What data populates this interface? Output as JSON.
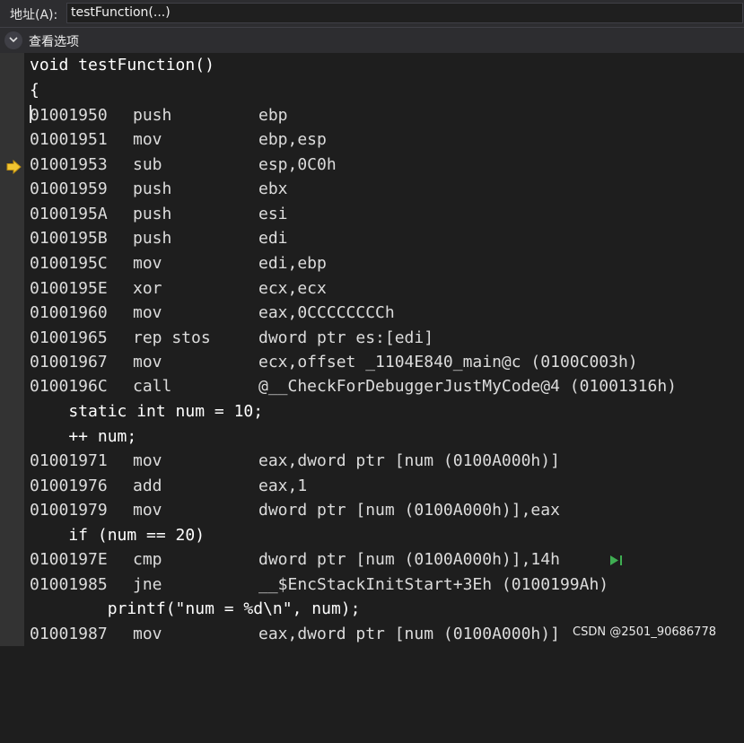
{
  "address_bar": {
    "label": "地址(A):",
    "value": "testFunction(...)"
  },
  "view_bar": {
    "label": "查看选项",
    "icon": "chevron-down-icon"
  },
  "source_lines": {
    "signature": "void testFunction()",
    "open_brace": "{",
    "static_decl": "    static int num = 10;",
    "increment": "    ++ num;",
    "if_stmt": "    if (num == 20)",
    "printf_stmt": "        printf(\"num = %d\\n\", num);"
  },
  "instructions": [
    {
      "address": "01001950",
      "mnemonic": "push",
      "operands": "ebp"
    },
    {
      "address": "01001951",
      "mnemonic": "mov",
      "operands": "ebp,esp"
    },
    {
      "address": "01001953",
      "mnemonic": "sub",
      "operands": "esp,0C0h"
    },
    {
      "address": "01001959",
      "mnemonic": "push",
      "operands": "ebx"
    },
    {
      "address": "0100195A",
      "mnemonic": "push",
      "operands": "esi"
    },
    {
      "address": "0100195B",
      "mnemonic": "push",
      "operands": "edi"
    },
    {
      "address": "0100195C",
      "mnemonic": "mov",
      "operands": "edi,ebp"
    },
    {
      "address": "0100195E",
      "mnemonic": "xor",
      "operands": "ecx,ecx"
    },
    {
      "address": "01001960",
      "mnemonic": "mov",
      "operands": "eax,0CCCCCCCCh"
    },
    {
      "address": "01001965",
      "mnemonic": "rep stos",
      "operands": "dword ptr es:[edi]"
    },
    {
      "address": "01001967",
      "mnemonic": "mov",
      "operands": "ecx,offset _1104E840_main@c (0100C003h)"
    },
    {
      "address": "0100196C",
      "mnemonic": "call",
      "operands": "@__CheckForDebuggerJustMyCode@4 (01001316h)"
    },
    {
      "address": "01001971",
      "mnemonic": "mov",
      "operands": "eax,dword ptr [num (0100A000h)]"
    },
    {
      "address": "01001976",
      "mnemonic": "add",
      "operands": "eax,1"
    },
    {
      "address": "01001979",
      "mnemonic": "mov",
      "operands": "dword ptr [num (0100A000h)],eax"
    },
    {
      "address": "0100197E",
      "mnemonic": "cmp",
      "operands": "dword ptr [num (0100A000h)],14h"
    },
    {
      "address": "01001985",
      "mnemonic": "jne",
      "operands": "__$EncStackInitStart+3Eh (0100199Ah)"
    },
    {
      "address": "01001987",
      "mnemonic": "mov",
      "operands": "eax,dword ptr [num (0100A000h)]"
    }
  ],
  "watermark": "CSDN @2501_90686778",
  "colors": {
    "background": "#1e1e1e",
    "gutter": "#333333",
    "text": "#dcdcdc",
    "arrow": "#f2c531",
    "run_to_click": "#3fae52"
  },
  "icons": {
    "current_line": "instruction-pointer-arrow-icon",
    "run_to_click": "run-to-click-icon"
  }
}
